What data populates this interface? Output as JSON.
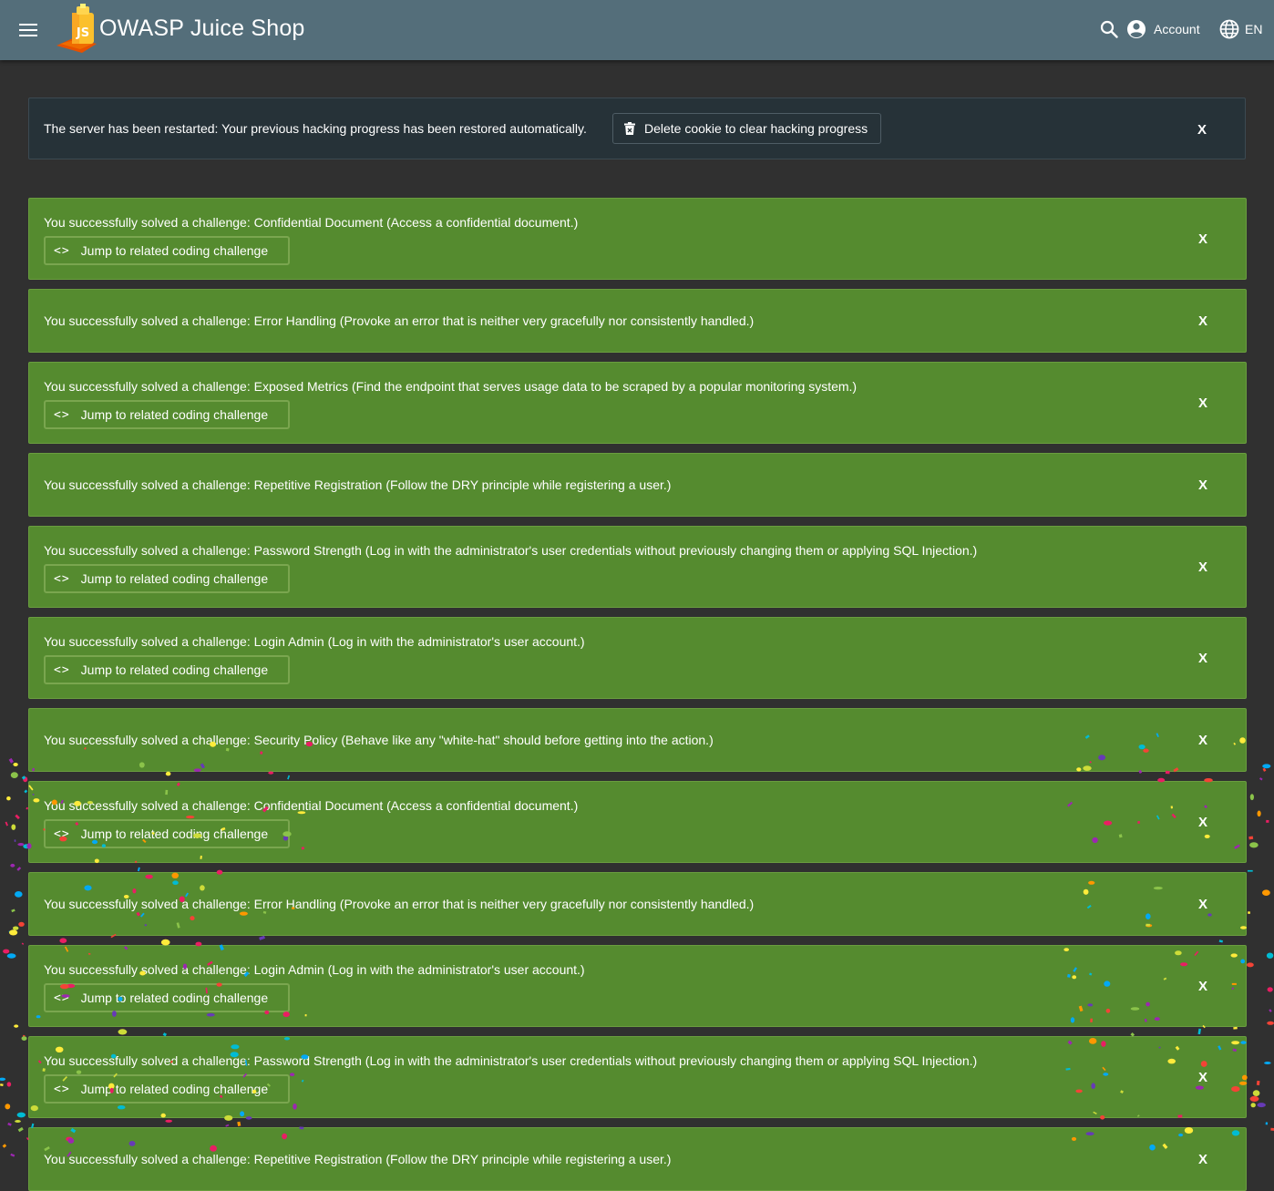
{
  "header": {
    "title": "OWASP Juice Shop",
    "logo_text": "JS",
    "account_label": "Account",
    "language_label": "EN"
  },
  "restart_banner": {
    "text": "The server has been restarted: Your previous hacking progress has been restored automatically.",
    "delete_button_label": "Delete cookie to clear hacking progress",
    "close_label": "X"
  },
  "notifications": [
    {
      "text": "You successfully solved a challenge: Confidential Document (Access a confidential document.)",
      "has_jump": true
    },
    {
      "text": "You successfully solved a challenge: Error Handling (Provoke an error that is neither very gracefully nor consistently handled.)",
      "has_jump": false
    },
    {
      "text": "You successfully solved a challenge: Exposed Metrics (Find the endpoint that serves usage data to be scraped by a popular monitoring system.)",
      "has_jump": true
    },
    {
      "text": "You successfully solved a challenge: Repetitive Registration (Follow the DRY principle while registering a user.)",
      "has_jump": false
    },
    {
      "text": "You successfully solved a challenge: Password Strength (Log in with the administrator's user credentials without previously changing them or applying SQL Injection.)",
      "has_jump": true
    },
    {
      "text": "You successfully solved a challenge: Login Admin (Log in with the administrator's user account.)",
      "has_jump": true
    },
    {
      "text": "You successfully solved a challenge: Security Policy (Behave like any \"white-hat\" should before getting into the action.)",
      "has_jump": false
    },
    {
      "text": "You successfully solved a challenge: Confidential Document (Access a confidential document.)",
      "has_jump": true
    },
    {
      "text": "You successfully solved a challenge: Error Handling (Provoke an error that is neither very gracefully nor consistently handled.)",
      "has_jump": false
    },
    {
      "text": "You successfully solved a challenge: Login Admin (Log in with the administrator's user account.)",
      "has_jump": true
    },
    {
      "text": "You successfully solved a challenge: Password Strength (Log in with the administrator's user credentials without previously changing them or applying SQL Injection.)",
      "has_jump": true
    },
    {
      "text": "You successfully solved a challenge: Repetitive Registration (Follow the DRY principle while registering a user.)",
      "has_jump": false
    }
  ],
  "jump_button_label": "Jump to related coding challenge",
  "close_label": "X",
  "icons": {
    "menu": "menu-icon",
    "search": "search-icon",
    "account": "account-circle-icon",
    "language": "globe-icon",
    "delete": "trash-icon",
    "code": "code-icon"
  },
  "colors": {
    "toolbar": "#546e7a",
    "background": "#303030",
    "banner": "#263238",
    "success": "#558b2f"
  }
}
